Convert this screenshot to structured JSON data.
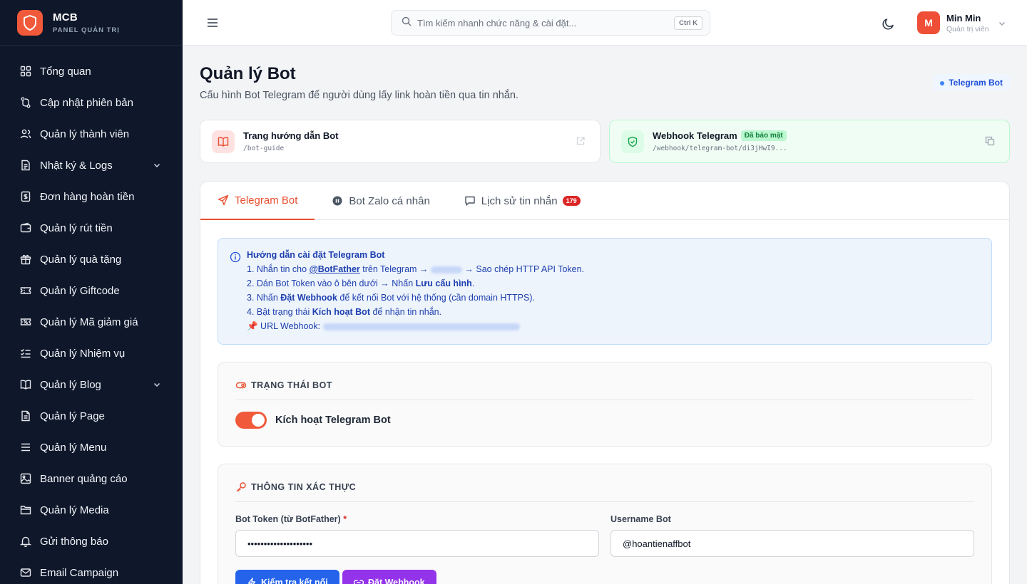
{
  "brand": {
    "name": "MCB",
    "subtitle": "PANEL QUẢN TRỊ"
  },
  "sidebar": {
    "items": [
      {
        "label": "Tổng quan",
        "icon": "dashboard-icon"
      },
      {
        "label": "Cập nhật phiên bản",
        "icon": "git-branch-icon"
      },
      {
        "label": "Quản lý thành viên",
        "icon": "users-icon"
      },
      {
        "label": "Nhật ký & Logs",
        "icon": "log-icon",
        "expandable": true
      },
      {
        "label": "Đơn hàng hoàn tiền",
        "icon": "receipt-icon"
      },
      {
        "label": "Quản lý rút tiền",
        "icon": "wallet-icon"
      },
      {
        "label": "Quản lý quà tặng",
        "icon": "gift-icon"
      },
      {
        "label": "Quản lý Giftcode",
        "icon": "ticket-icon"
      },
      {
        "label": "Quản lý Mã giảm giá",
        "icon": "coupon-icon"
      },
      {
        "label": "Quản lý Nhiệm vụ",
        "icon": "checklist-icon"
      },
      {
        "label": "Quản lý Blog",
        "icon": "book-icon",
        "expandable": true
      },
      {
        "label": "Quản lý Page",
        "icon": "page-icon"
      },
      {
        "label": "Quản lý Menu",
        "icon": "menu-icon"
      },
      {
        "label": "Banner quảng cáo",
        "icon": "image-icon"
      },
      {
        "label": "Quản lý Media",
        "icon": "folder-icon"
      },
      {
        "label": "Gửi thông báo",
        "icon": "bell-icon"
      },
      {
        "label": "Email Campaign",
        "icon": "mail-icon"
      }
    ]
  },
  "header": {
    "search_placeholder": "Tìm kiếm nhanh chức năng & cài đặt...",
    "search_shortcut": "Ctrl K",
    "user": {
      "initial": "M",
      "name": "Min Min",
      "role": "Quản trị viên"
    }
  },
  "page": {
    "title": "Quản lý Bot",
    "subtitle": "Cấu hình Bot Telegram để người dùng lấy link hoàn tiền qua tin nhắn.",
    "badge": "Telegram Bot"
  },
  "cards": {
    "guide": {
      "title": "Trang hướng dẫn Bot",
      "path": "/bot-guide"
    },
    "webhook": {
      "title": "Webhook Telegram",
      "badge": "Đã bảo mật",
      "path": "/webhook/telegram-bot/di3jHwI9..."
    }
  },
  "tabs": [
    {
      "label": "Telegram Bot",
      "active": true
    },
    {
      "label": "Bot Zalo cá nhân"
    },
    {
      "label": "Lịch sử tin nhắn",
      "count": "179"
    }
  ],
  "instructions": {
    "title": "Hướng dẫn cài đặt Telegram Bot",
    "l1_a": "1. Nhắn tin cho ",
    "l1_link": "@BotFather",
    "l1_b": " trên Telegram → ",
    "l1_c": " → Sao chép HTTP API Token.",
    "l2_a": "2. Dán Bot Token vào ô bên dưới → Nhấn ",
    "l2_b": "Lưu cấu hình",
    "l2_c": ".",
    "l3_a": "3. Nhấn ",
    "l3_b": "Đặt Webhook",
    "l3_c": " để kết nối Bot với hệ thống (cần domain HTTPS).",
    "l4_a": "4. Bật trạng thái ",
    "l4_b": "Kích hoạt Bot",
    "l4_c": " để nhận tin nhắn.",
    "l5_a": "📌 URL Webhook: "
  },
  "status_section": {
    "title": "TRẠNG THÁI BOT",
    "toggle_label": "Kích hoạt Telegram Bot",
    "enabled": true
  },
  "auth_section": {
    "title": "THÔNG TIN XÁC THỰC",
    "token_label": "Bot Token (từ BotFather)",
    "required_mark": "*",
    "token_value": "••••••••••••••••••••",
    "username_label": "Username Bot",
    "username_value": "@hoantienaffbot",
    "test_button": "Kiểm tra kết nối",
    "webhook_button": "Đặt Webhook"
  },
  "colors": {
    "accent": "#e8502f",
    "sidebar_bg": "#0f172a",
    "primary_blue": "#2563eb",
    "purple": "#9333ea"
  }
}
